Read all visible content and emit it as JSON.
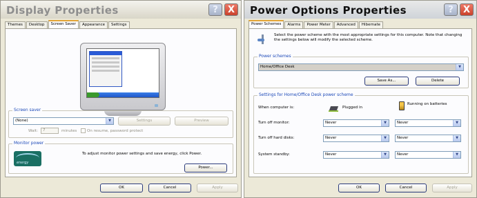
{
  "display_properties": {
    "title": "Display Properties",
    "help_glyph": "?",
    "close_glyph": "X",
    "tabs": [
      "Themes",
      "Desktop",
      "Screen Saver",
      "Appearance",
      "Settings"
    ],
    "active_tab": "Screen Saver",
    "screen_saver": {
      "group_label": "Screen saver",
      "selected": "(None)",
      "settings_label": "Settings",
      "preview_label": "Preview",
      "wait_label": "Wait:",
      "wait_value": "7",
      "minutes_label": "minutes",
      "password_label": "On resume, password protect"
    },
    "monitor_power": {
      "group_label": "Monitor power",
      "description": "To adjust monitor power settings and save energy, click Power.",
      "logo_text": "energy",
      "power_button": "Power..."
    },
    "footer": {
      "ok": "OK",
      "cancel": "Cancel",
      "apply": "Apply"
    }
  },
  "power_options": {
    "title": "Power Options Properties",
    "help_glyph": "?",
    "close_glyph": "X",
    "tabs": [
      "Power Schemes",
      "Alarms",
      "Power Meter",
      "Advanced",
      "Hibernate"
    ],
    "active_tab": "Power Schemes",
    "intro": "Select the power scheme with the most appropriate settings for this computer. Note that changing the settings below will modify the selected scheme.",
    "schemes": {
      "group_label": "Power schemes",
      "selected": "Home/Office Desk",
      "save_as": "Save As...",
      "delete": "Delete"
    },
    "settings": {
      "group_label": "Settings for Home/Office Desk power scheme",
      "when_label": "When computer is:",
      "plugged_in": "Plugged in",
      "running_on_batteries": "Running on batteries",
      "rows": [
        {
          "label": "Turn off monitor:",
          "plugged": "Never",
          "battery": "Never"
        },
        {
          "label": "Turn off hard disks:",
          "plugged": "Never",
          "battery": "Never"
        },
        {
          "label": "System standby:",
          "plugged": "Never",
          "battery": "Never"
        }
      ]
    },
    "footer": {
      "ok": "OK",
      "cancel": "Cancel",
      "apply": "Apply"
    }
  },
  "colors": {
    "title_accent": "#1c49b8",
    "active_tab_accent": "#e3a434",
    "close_red": "#d9543f"
  }
}
